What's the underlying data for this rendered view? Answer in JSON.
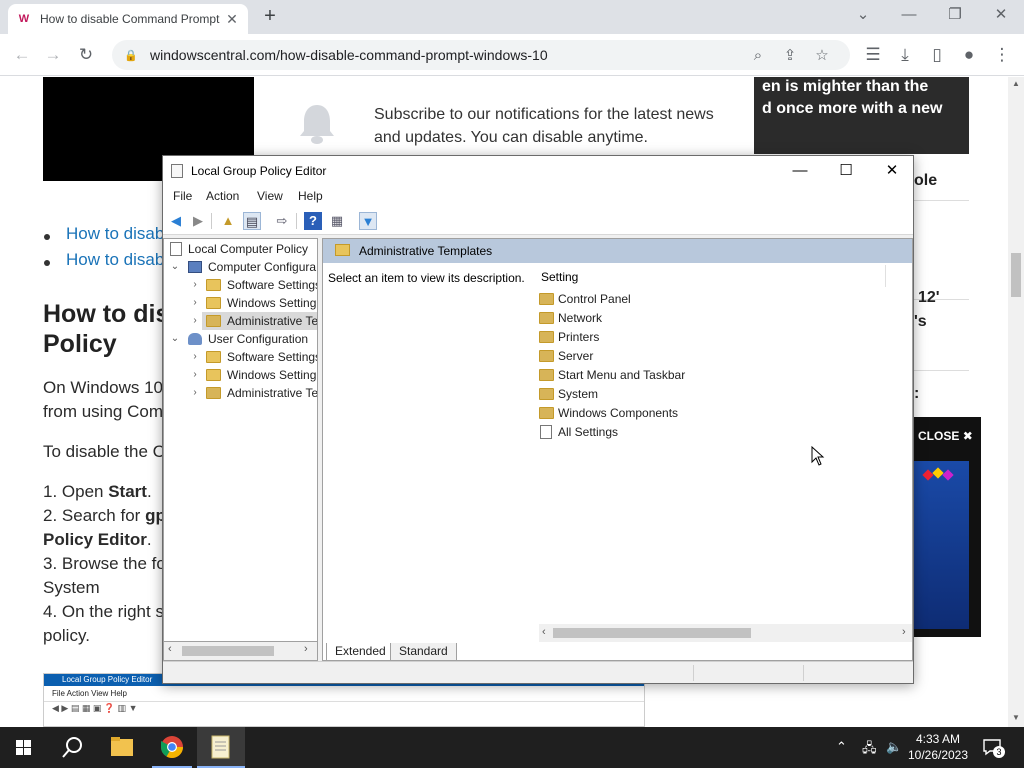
{
  "browser": {
    "tab_title": "How to disable Command Prompt",
    "tab_close": "✕",
    "new_tab": "+",
    "url": "windowscentral.com/how-disable-command-prompt-windows-10",
    "min": "—",
    "restore": "❐",
    "close": "✕",
    "chevron": "⌄"
  },
  "page": {
    "notif_text": "Subscribe to our notifications for the latest news and updates. You can disable anytime.",
    "promo_line1": "en is mighter than the",
    "promo_line2": "d once more with a new",
    "right_frag1": "ole",
    "right_frag2": "12'",
    "right_frag3": "'s",
    "right_frag4": ":",
    "bullet1": "How to disab",
    "bullet2": "How to disab",
    "heading_l1": "How to dis",
    "heading_l2": "Policy",
    "para1_l1": "On Windows 10",
    "para1_l2": "from using Com",
    "para2": "To disable the C",
    "step1_pre": "1. Open ",
    "step1_bold": "Start",
    "step1_post": ".",
    "step2_pre": "2. Search for ",
    "step2_bold": "gp",
    "step2_l2_bold": "Policy Editor",
    "step2_l2_post": ".",
    "step3_l1": "3. Browse the fo",
    "step3_l2": "System",
    "step4_l1": "4. On the right s",
    "step4_l2": "policy.",
    "ad_close": "CLOSE",
    "mini_title": "Local Group Policy Editor",
    "mini_menu": "File   Action   View   Help"
  },
  "gpe": {
    "title": "Local Group Policy Editor",
    "min": "—",
    "max": "☐",
    "close": "✕",
    "menu": [
      "File",
      "Action",
      "View",
      "Help"
    ],
    "tree": {
      "root": "Local Computer Policy",
      "computer": "Computer Configura",
      "c_software": "Software Settings",
      "c_windows": "Windows Setting",
      "c_admin": "Administrative Te",
      "user": "User Configuration",
      "u_software": "Software Settings",
      "u_windows": "Windows Setting",
      "u_admin": "Administrative Te"
    },
    "header": "Administrative Templates",
    "description": "Select an item to view its description.",
    "column": "Setting",
    "items": [
      "Control Panel",
      "Network",
      "Printers",
      "Server",
      "Start Menu and Taskbar",
      "System",
      "Windows Components",
      "All Settings"
    ],
    "tabs": [
      "Extended",
      "Standard"
    ]
  },
  "taskbar": {
    "time": "4:33 AM",
    "date": "10/26/2023",
    "notifications": "3"
  },
  "colors": {
    "tab_strip": "#dee1e6",
    "header_band": "#b8c8dc",
    "taskbar": "#1f1f1f",
    "link": "#1a73b8"
  }
}
